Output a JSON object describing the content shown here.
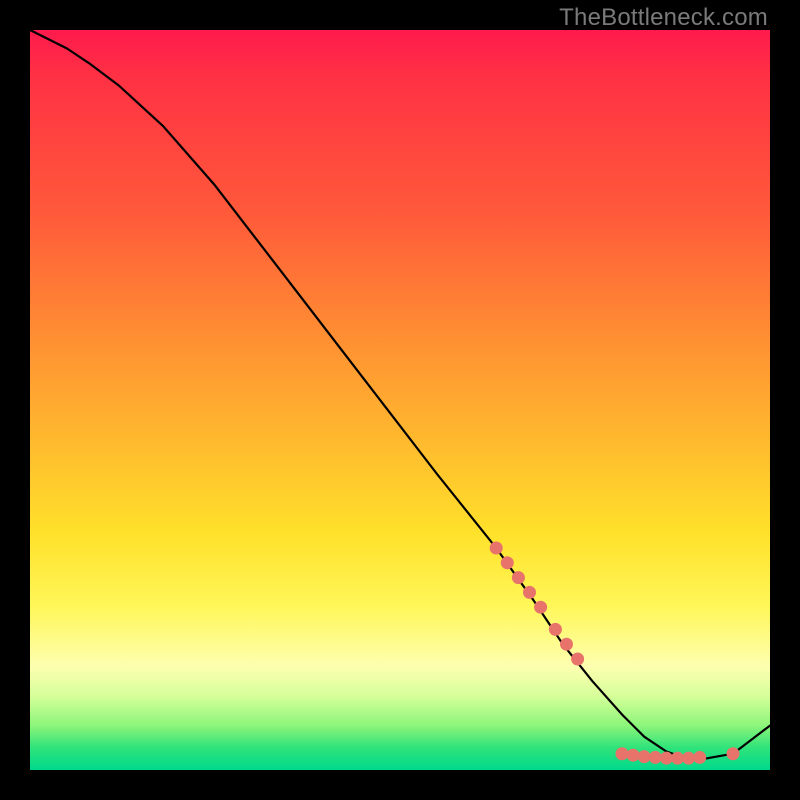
{
  "watermark": "TheBottleneck.com",
  "chart_data": {
    "type": "line",
    "title": "",
    "xlabel": "",
    "ylabel": "",
    "xlim": [
      0,
      100
    ],
    "ylim": [
      0,
      100
    ],
    "grid": false,
    "legend": false,
    "series": [
      {
        "name": "curve",
        "style": "line",
        "color": "#000000",
        "x": [
          0,
          2,
          5,
          8,
          12,
          18,
          25,
          35,
          45,
          55,
          63,
          68,
          72,
          76,
          80,
          83,
          86,
          88,
          91,
          95,
          100
        ],
        "y": [
          100,
          99,
          97.5,
          95.5,
          92.5,
          87,
          79,
          66,
          53,
          40,
          30,
          23,
          17,
          12,
          7.5,
          4.5,
          2.5,
          1.8,
          1.5,
          2.2,
          6
        ]
      },
      {
        "name": "points",
        "style": "scatter",
        "color": "#e8736b",
        "x": [
          63,
          64.5,
          66,
          67.5,
          69,
          71,
          72.5,
          74,
          80,
          81.5,
          83,
          84.5,
          86,
          87.5,
          89,
          90.5,
          95
        ],
        "y": [
          30,
          28,
          26,
          24,
          22,
          19,
          17,
          15,
          2.2,
          2.0,
          1.8,
          1.7,
          1.6,
          1.6,
          1.6,
          1.7,
          2.2
        ]
      }
    ]
  }
}
